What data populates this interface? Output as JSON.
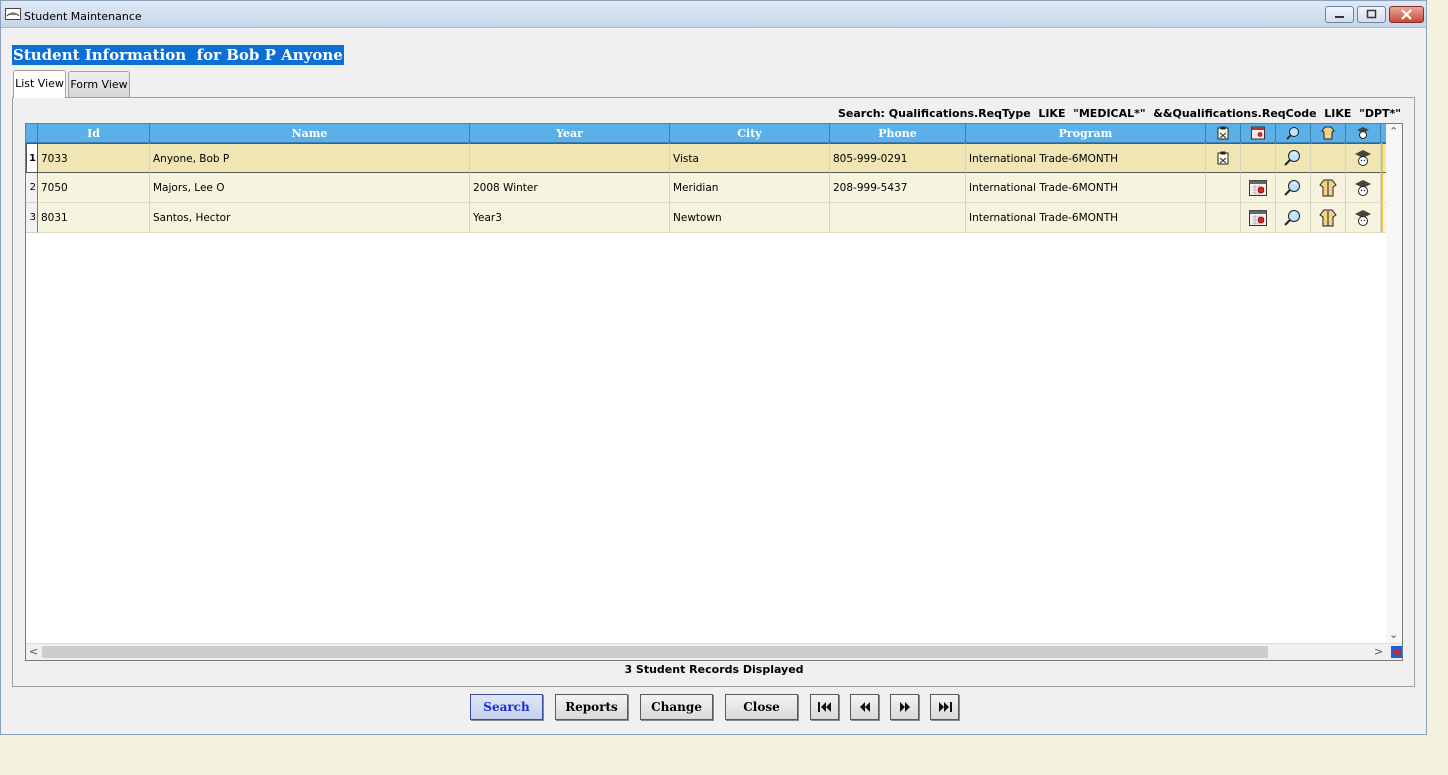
{
  "window": {
    "title": "Student Maintenance"
  },
  "heading": "Student Information  for Bob P Anyone",
  "tabs": [
    {
      "label": "List View",
      "active": true
    },
    {
      "label": "Form View",
      "active": false
    }
  ],
  "search_text": "Search: Qualifications.ReqType  LIKE  \"MEDICAL*\"  &&Qualifications.ReqCode  LIKE  \"DPT*\"",
  "columns": [
    "Id",
    "Name",
    "Year",
    "City",
    "Phone",
    "Program"
  ],
  "icon_columns": [
    "clipboard-icon",
    "calendar-icon",
    "lookup-icon",
    "jacket-icon",
    "graduate-icon"
  ],
  "rows": [
    {
      "num": "1",
      "id": "7033",
      "name": "Anyone, Bob P",
      "year": "",
      "city": "Vista",
      "phone": "805-999-0291",
      "program": "International Trade-6MONTH",
      "icons": [
        "clipboard-icon",
        "",
        "lookup-icon",
        "",
        "graduate-icon"
      ],
      "selected": true
    },
    {
      "num": "2",
      "id": "7050",
      "name": "Majors, Lee O",
      "year": "2008 Winter",
      "city": "Meridian",
      "phone": "208-999-5437",
      "program": "International Trade-6MONTH",
      "icons": [
        "",
        "calendar-icon",
        "lookup-icon",
        "jacket-icon",
        "graduate-icon"
      ],
      "selected": false
    },
    {
      "num": "3",
      "id": "8031",
      "name": "Santos, Hector",
      "year": "Year3",
      "city": "Newtown",
      "phone": "",
      "program": "International Trade-6MONTH",
      "icons": [
        "",
        "calendar-icon",
        "lookup-icon",
        "jacket-icon",
        "graduate-icon"
      ],
      "selected": false
    }
  ],
  "status": "3 Student Records Displayed",
  "buttons": {
    "search": "Search",
    "reports": "Reports",
    "change": "Change",
    "close": "Close"
  },
  "colors": {
    "header_blue": "#5bb0e8",
    "heading_bg": "#0b6fd6",
    "row_bg": "#f6f4df",
    "selected_row_bg": "#efe6b3",
    "primary_button_text": "#1a2fd0"
  }
}
